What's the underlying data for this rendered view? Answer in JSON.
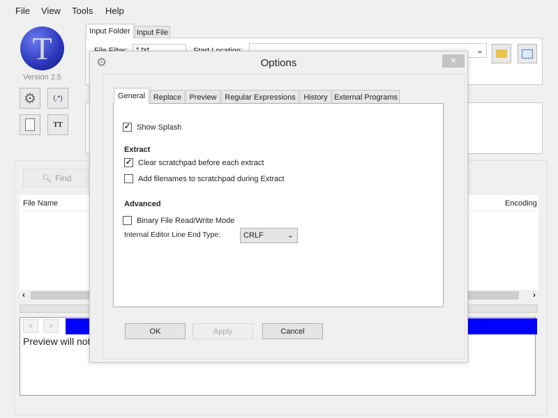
{
  "menu": [
    "File",
    "View",
    "Tools",
    "Help"
  ],
  "logo": {
    "letter": "T",
    "version": "Version 2.5"
  },
  "tool_icons": [
    "gear-icon",
    "regex-icon",
    "document-icon",
    "font-size-icon"
  ],
  "tool_icon_text": {
    "regex": "(.*)",
    "font": "TT"
  },
  "input_tabs": [
    "Input Folder",
    "Input File"
  ],
  "file_filter": {
    "label": "File Filter:",
    "value": "*.txt"
  },
  "start_location": {
    "label": "Start Location:",
    "value": ""
  },
  "find_button": "Find",
  "file_list": {
    "columns": [
      "File Name",
      "Encoding"
    ]
  },
  "preview": {
    "text": "Preview will not b",
    "bar_color": "#0000ff"
  },
  "dialog": {
    "title": "Options",
    "close": "×",
    "tabs": [
      "General",
      "Replace",
      "Preview",
      "Regular Expressions",
      "History",
      "External Programs"
    ],
    "active_tab": "General",
    "show_splash": {
      "label": "Show Splash",
      "checked": true
    },
    "extract_heading": "Extract",
    "clear_scratchpad": {
      "label": "Clear scratchpad before each extract",
      "checked": true
    },
    "add_filenames": {
      "label": "Add filenames to scratchpad during Extract",
      "checked": false
    },
    "advanced_heading": "Advanced",
    "binary_mode": {
      "label": "Binary File Read/Write Mode",
      "checked": false
    },
    "line_end": {
      "label": "Internal Editor Line End Type:",
      "value": "CRLF"
    },
    "buttons": {
      "ok": "OK",
      "apply": "Apply",
      "cancel": "Cancel"
    }
  }
}
